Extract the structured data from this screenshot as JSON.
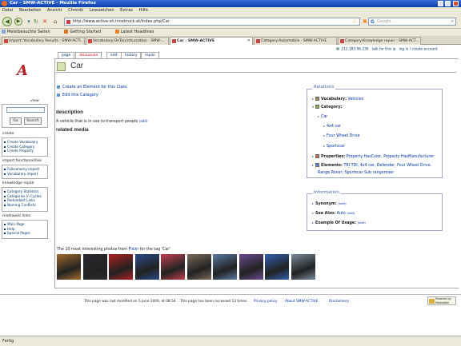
{
  "window": {
    "title": "Car - SMW-ACTIVE - Mozilla Firefox"
  },
  "menu": [
    "Datei",
    "Bearbeiten",
    "Ansicht",
    "Chronik",
    "Lesezeichen",
    "Extras",
    "Hilfe"
  ],
  "nav": {
    "url": "http://www.active-sh.innsbruck.at/index.php/Car",
    "search_placeholder": "Google"
  },
  "bookmarks": [
    "Meistbesuchte Seiten",
    "Getting Started",
    "Latest Headlines"
  ],
  "tabs": [
    {
      "label": "Import::Vocabulary Results - SMW-ACTI..."
    },
    {
      "label": "Vocabulary:OnTouristLocation - SMW-..."
    },
    {
      "label": "Car - SMW-ACTIVE",
      "active": true
    },
    {
      "label": "Category:Automobile - SMW-ACTIVE"
    },
    {
      "label": "Category:Knowledge repair - SMW-ACT..."
    }
  ],
  "page_tabs": [
    "page",
    "discussion",
    "edit",
    "history",
    "repair"
  ],
  "personal": {
    "ip": "212.183.96.230",
    "talk": "talk for this ip",
    "login": "log in / create account"
  },
  "page": {
    "title": "Car",
    "actions": [
      "Create an Element for this Class",
      "Edit this Category"
    ],
    "description_heading": "description",
    "description_text": "A vehicle that is in use to transport people",
    "description_edit": "(edit)",
    "related_heading": "related media"
  },
  "relations": {
    "title": "Relations",
    "vocabulary_label": "Vocabulary:",
    "vocabulary_value": "Vehicles",
    "category_label": "Category:",
    "category_items": [
      "Car",
      "4x4 car",
      "Four Wheel Drive",
      "Sportscar"
    ],
    "properties_label": "Properties:",
    "properties_value": "Property HasColor, Property HasManufacturer",
    "elements_label": "Elements:",
    "elements_line1": "TRI TDI, 4x4 car, Defender, Four Wheel Drive,",
    "elements_line2": "Range Rover, Sportscar Sub rangerover"
  },
  "information": {
    "title": "Information",
    "synonym_label": "Synonym:",
    "synonym_edit": "(edit)",
    "seealso_label": "See Also:",
    "seealso_value": "Auto",
    "seealso_edit": "(edit)",
    "example_label": "Example Of Usage:",
    "example_edit": "(edit)"
  },
  "flickr": {
    "caption_pre": "The 10 most interesting photos from",
    "caption_link": "Flickr",
    "caption_post": "for the tag 'Car'",
    "photo_colors": [
      "#a06a2a",
      "#2a2a30",
      "#b02020",
      "#2a4a8a",
      "#c04050",
      "#7a6a5a",
      "#5a7aa0",
      "#6a4a90",
      "#3060b0",
      "#7a8a9a"
    ]
  },
  "sidebar": {
    "view_label": "view",
    "go_button": "Go",
    "search_button": "Search",
    "sections": [
      {
        "title": "create",
        "items": [
          "Create Vocabulary",
          "Create Category",
          "Create Property"
        ]
      },
      {
        "title": "import functionalities",
        "items": [
          "Folksonomy import",
          "Vocabulary import"
        ]
      },
      {
        "title": "knowledge repair",
        "items": [
          "Category Statistics",
          "Categories in Cycles",
          "Redundant Links",
          "Naming Conflicts"
        ]
      },
      {
        "title": "mediawiki links",
        "items": [
          "Main Page",
          "Help",
          "Special Pages"
        ]
      }
    ]
  },
  "footer": {
    "modified": "This page was last modified on 5 June 2009, at 08:54.",
    "accessed": "This page has been accessed 13 times.",
    "privacy": "Privacy policy",
    "about": "About SMW-ACTIVE",
    "disclaimers": "Disclaimers",
    "badge": "Powered by MediaWiki"
  },
  "status": "Fertig"
}
